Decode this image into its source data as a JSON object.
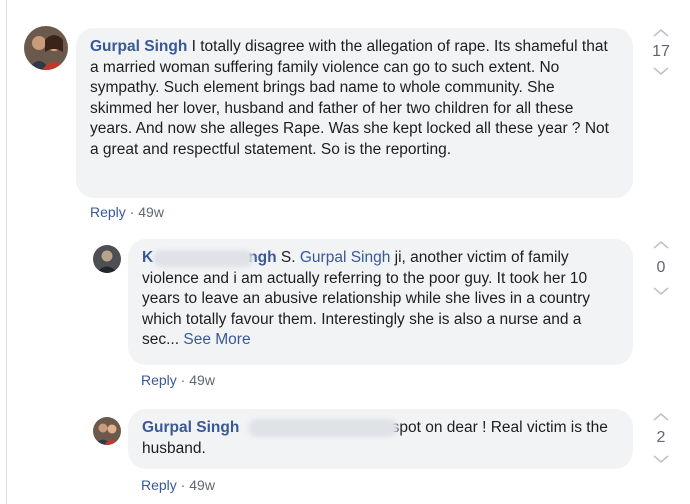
{
  "comments": [
    {
      "author": "Gurpal Singh",
      "text": " I totally disagree with the allegation of rape. Its shameful that a married woman suffering family violence can go to such extent. No sympathy. Such element brings bad name to whole community. She skimmed her lover, husband and father of her two children for all these years. And now she alleges Rape. Was she kept locked all these year ? Not a great and respectful statement. So is the reporting.",
      "reply_label": "Reply",
      "separator": " · ",
      "time": "49w",
      "votes": "17"
    },
    {
      "author_partial": "K",
      "author_tail": "ngh",
      "mention": "Gurpal Singh",
      "text_pre": " S. ",
      "text": " ji, another victim of family violence and i am actually referring to the poor guy. It took her 10 years to leave an abusive relationship while she lives in a country which totally favour them. Interestingly she is also a nurse and a sec... ",
      "see_more": "See More",
      "reply_label": "Reply",
      "separator": " · ",
      "time": "49w",
      "votes": "0"
    },
    {
      "author_partial": "Gurpal Singh",
      "text": " spot on dear ! Real victim is the husband.",
      "reply_label": "Reply",
      "separator": " · ",
      "time": "49w",
      "votes": "2"
    }
  ],
  "colors": {
    "link": "#385898",
    "bubble": "#f2f3f5",
    "meta": "#606770"
  },
  "icons": [
    "avatar-couple",
    "avatar-user",
    "chevron-up-icon",
    "chevron-down-icon"
  ]
}
